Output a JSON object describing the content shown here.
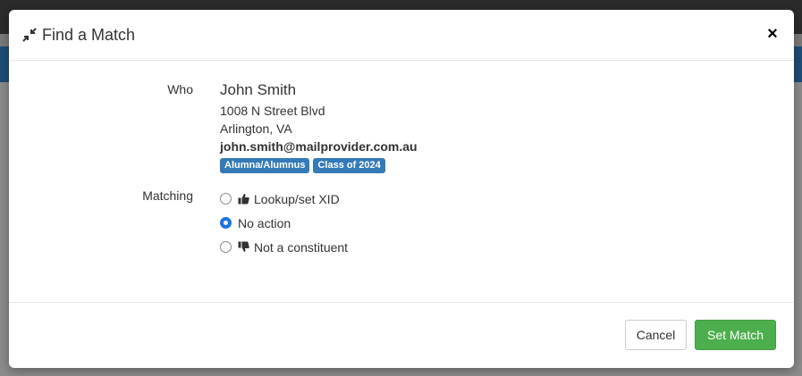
{
  "modal": {
    "title": "Find a Match",
    "close_label": "×",
    "who_label": "Who",
    "person": {
      "name": "John Smith",
      "address_line1": "1008 N Street Blvd",
      "address_line2": "Arlington, VA",
      "email": "john.smith@mailprovider.com.au",
      "tags": [
        "Alumna/Alumnus",
        "Class of 2024"
      ]
    },
    "matching_label": "Matching",
    "options": [
      {
        "label": "Lookup/set XID",
        "icon": "thumbs-up-icon",
        "checked": false
      },
      {
        "label": "No action",
        "icon": "",
        "checked": true
      },
      {
        "label": "Not a constituent",
        "icon": "thumbs-down-icon",
        "checked": false
      }
    ],
    "cancel_label": "Cancel",
    "submit_label": "Set Match"
  },
  "colors": {
    "tag_bg": "#337ab7",
    "submit_bg": "#4cae4c",
    "radio_checked": "#1a73e8"
  }
}
